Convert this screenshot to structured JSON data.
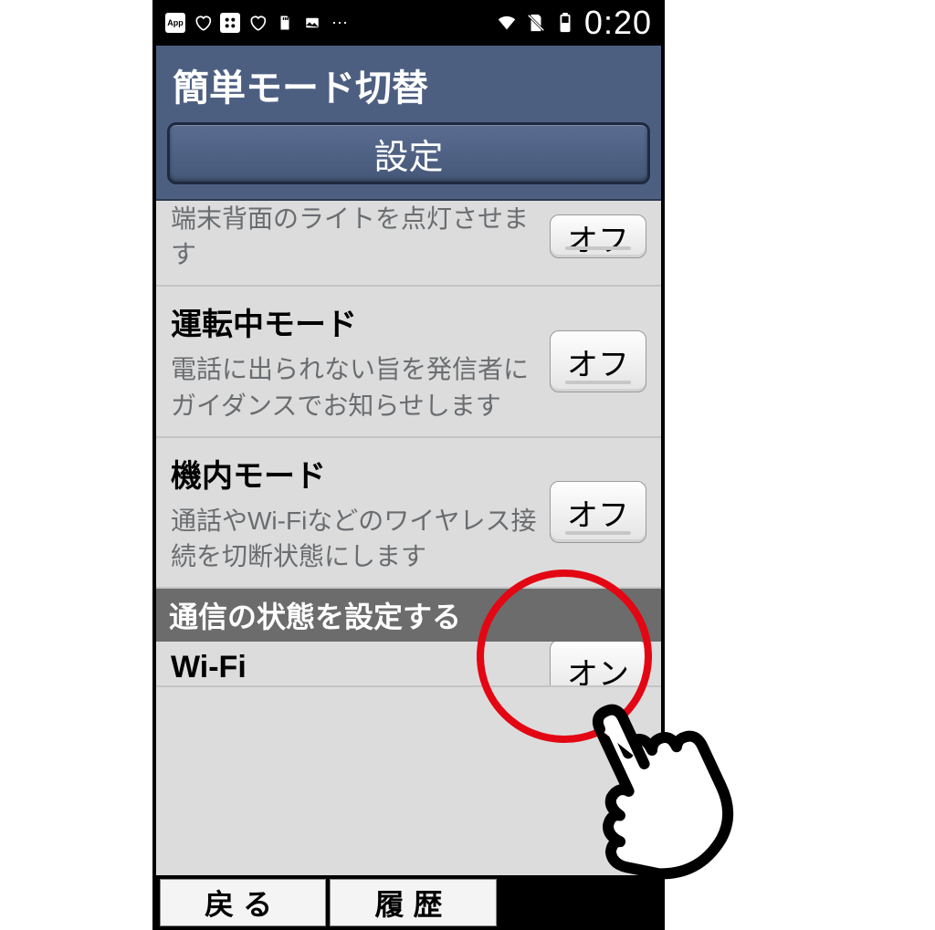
{
  "statusbar": {
    "clock": "0:20"
  },
  "header": {
    "title": "簡単モード切替",
    "settings_button": "設定"
  },
  "rows": {
    "light": {
      "desc": "端末背面のライトを点灯させます",
      "toggle": "オフ"
    },
    "driving": {
      "title": "運転中モード",
      "desc": "電話に出られない旨を発信者にガイダンスでお知らせします",
      "toggle": "オフ"
    },
    "airplane": {
      "title": "機内モード",
      "desc": "通話やWi-Fiなどのワイヤレス接続を切断状態にします",
      "toggle": "オフ"
    },
    "wifi": {
      "title": "Wi-Fi",
      "toggle": "オン"
    }
  },
  "section": {
    "comm": "通信の状態を設定する"
  },
  "softbar": {
    "back": "戻る",
    "history": "履歴"
  }
}
